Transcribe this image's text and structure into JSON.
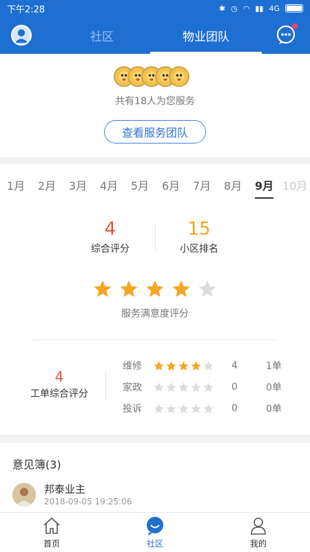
{
  "status_bar": {
    "time": "下午2:28",
    "network_label": "4G"
  },
  "header": {
    "tabs": [
      {
        "label": "社区"
      },
      {
        "label": "物业团队"
      }
    ],
    "active_tab": "物业团队"
  },
  "team": {
    "count_text": "共有18人为您服务",
    "view_button": "查看服务团队"
  },
  "months": {
    "items": [
      "1月",
      "2月",
      "3月",
      "4月",
      "5月",
      "6月",
      "7月",
      "8月",
      "9月",
      "10月"
    ],
    "selected": "9月",
    "disabled": "10月"
  },
  "scores": {
    "overall": {
      "value": "4",
      "label": "综合评分"
    },
    "rank": {
      "value": "15",
      "label": "小区排名"
    },
    "satisfaction": {
      "stars": 4,
      "max": 5,
      "label": "服务满意度评分"
    },
    "work_order": {
      "value": "4",
      "label": "工单综合评分"
    },
    "categories": [
      {
        "name": "维修",
        "stars": 4,
        "count": "4",
        "unit": "1单"
      },
      {
        "name": "家政",
        "stars": 0,
        "count": "0",
        "unit": "0单"
      },
      {
        "name": "投诉",
        "stars": 0,
        "count": "0",
        "unit": "0单"
      }
    ]
  },
  "notes": {
    "title": "意见簿(3)",
    "entries": [
      {
        "name": "邦泰业主",
        "time": "2018-09-05 19:25:06"
      }
    ]
  },
  "bottom_nav": [
    {
      "label": "首页",
      "icon": "home-icon"
    },
    {
      "label": "社区",
      "icon": "community-icon"
    },
    {
      "label": "我的",
      "icon": "user-icon"
    }
  ],
  "colors": {
    "primary": "#1f6fd3",
    "overall_score": "#e5533d",
    "rank": "#f3a619",
    "star_on": "#f5a623",
    "star_off": "#dcdcdc"
  }
}
